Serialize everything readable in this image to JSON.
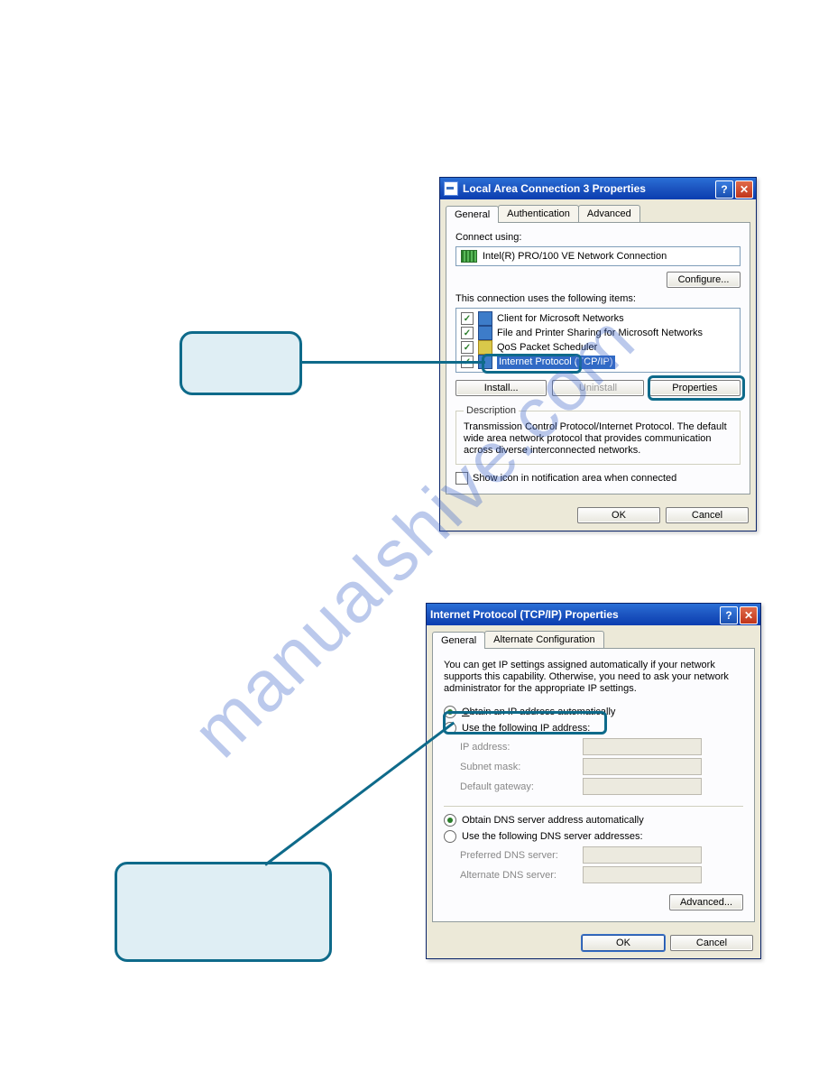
{
  "watermark": "manualshive.com",
  "dialog1": {
    "title": "Local Area Connection 3 Properties",
    "tabs": [
      "General",
      "Authentication",
      "Advanced"
    ],
    "connect_label": "Connect using:",
    "nic": "Intel(R) PRO/100 VE Network Connection",
    "configure": "Configure...",
    "uses_label": "This connection uses the following items:",
    "items": [
      "Client for Microsoft Networks",
      "File and Printer Sharing for Microsoft Networks",
      "QoS Packet Scheduler",
      "Internet Protocol (TCP/IP)"
    ],
    "install": "Install...",
    "uninstall": "Uninstall",
    "properties": "Properties",
    "desc_legend": "Description",
    "desc_text": "Transmission Control Protocol/Internet Protocol. The default wide area network protocol that provides communication across diverse interconnected networks.",
    "show_icon": "Show icon in notification area when connected",
    "ok": "OK",
    "cancel": "Cancel"
  },
  "dialog2": {
    "title": "Internet Protocol (TCP/IP) Properties",
    "tabs": [
      "General",
      "Alternate Configuration"
    ],
    "intro": "You can get IP settings assigned automatically if your network supports this capability. Otherwise, you need to ask your network administrator for the appropriate IP settings.",
    "r1": "Obtain an IP address automatically",
    "r2": "Use the following IP address:",
    "ip_label": "IP address:",
    "mask_label": "Subnet mask:",
    "gw_label": "Default gateway:",
    "r3": "Obtain DNS server address automatically",
    "r4": "Use the following DNS server addresses:",
    "pref_dns": "Preferred DNS server:",
    "alt_dns": "Alternate DNS server:",
    "advanced": "Advanced...",
    "ok": "OK",
    "cancel": "Cancel"
  }
}
